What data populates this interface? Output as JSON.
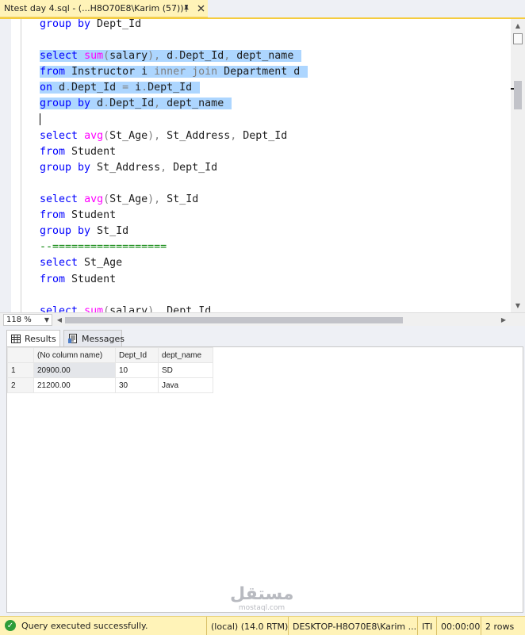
{
  "tab": {
    "title": "Ntest day 4.sql - (...H8O70E8\\Karim (57))",
    "pin_icon": "pin-icon",
    "close_icon": "close-icon"
  },
  "editor": {
    "lines": [
      {
        "parts": [
          {
            "t": "group by",
            "c": "kw"
          },
          {
            "t": " Dept_Id",
            "c": ""
          }
        ]
      },
      {
        "parts": []
      },
      {
        "sel": true,
        "parts": [
          {
            "t": "select",
            "c": "kw"
          },
          {
            "t": " ",
            "c": ""
          },
          {
            "t": "sum",
            "c": "fn"
          },
          {
            "t": "(",
            "c": "gray"
          },
          {
            "t": "salary",
            "c": ""
          },
          {
            "t": "),",
            "c": "gray"
          },
          {
            "t": " d",
            "c": ""
          },
          {
            "t": ".",
            "c": "gray"
          },
          {
            "t": "Dept_Id",
            "c": ""
          },
          {
            "t": ",",
            "c": "gray"
          },
          {
            "t": " dept_name ",
            "c": ""
          }
        ]
      },
      {
        "sel": true,
        "parts": [
          {
            "t": "from",
            "c": "kw"
          },
          {
            "t": " Instructor i ",
            "c": ""
          },
          {
            "t": "inner join",
            "c": "gray"
          },
          {
            "t": " Department d ",
            "c": ""
          }
        ]
      },
      {
        "sel": true,
        "parts": [
          {
            "t": "on",
            "c": "kw"
          },
          {
            "t": " d",
            "c": ""
          },
          {
            "t": ".",
            "c": "gray"
          },
          {
            "t": "Dept_Id ",
            "c": ""
          },
          {
            "t": "=",
            "c": "gray"
          },
          {
            "t": " i",
            "c": ""
          },
          {
            "t": ".",
            "c": "gray"
          },
          {
            "t": "Dept_Id ",
            "c": ""
          }
        ]
      },
      {
        "sel": true,
        "parts": [
          {
            "t": "group by",
            "c": "kw"
          },
          {
            "t": " d",
            "c": ""
          },
          {
            "t": ".",
            "c": "gray"
          },
          {
            "t": "Dept_Id",
            "c": ""
          },
          {
            "t": ",",
            "c": "gray"
          },
          {
            "t": " dept_name ",
            "c": ""
          }
        ]
      },
      {
        "caret": true,
        "parts": []
      },
      {
        "parts": [
          {
            "t": "select",
            "c": "kw"
          },
          {
            "t": " ",
            "c": ""
          },
          {
            "t": "avg",
            "c": "fn"
          },
          {
            "t": "(",
            "c": "gray"
          },
          {
            "t": "St_Age",
            "c": ""
          },
          {
            "t": "),",
            "c": "gray"
          },
          {
            "t": " St_Address",
            "c": ""
          },
          {
            "t": ",",
            "c": "gray"
          },
          {
            "t": " Dept_Id",
            "c": ""
          }
        ]
      },
      {
        "parts": [
          {
            "t": "from",
            "c": "kw"
          },
          {
            "t": " Student",
            "c": ""
          }
        ]
      },
      {
        "parts": [
          {
            "t": "group by",
            "c": "kw"
          },
          {
            "t": " St_Address",
            "c": ""
          },
          {
            "t": ",",
            "c": "gray"
          },
          {
            "t": " Dept_Id",
            "c": ""
          }
        ]
      },
      {
        "parts": []
      },
      {
        "parts": [
          {
            "t": "select",
            "c": "kw"
          },
          {
            "t": " ",
            "c": ""
          },
          {
            "t": "avg",
            "c": "fn"
          },
          {
            "t": "(",
            "c": "gray"
          },
          {
            "t": "St_Age",
            "c": ""
          },
          {
            "t": "),",
            "c": "gray"
          },
          {
            "t": " St_Id",
            "c": ""
          }
        ]
      },
      {
        "parts": [
          {
            "t": "from",
            "c": "kw"
          },
          {
            "t": " Student",
            "c": ""
          }
        ]
      },
      {
        "parts": [
          {
            "t": "group by",
            "c": "kw"
          },
          {
            "t": " St_Id",
            "c": ""
          }
        ]
      },
      {
        "parts": [
          {
            "t": "--==================",
            "c": "cmt"
          }
        ]
      },
      {
        "parts": [
          {
            "t": "select",
            "c": "kw"
          },
          {
            "t": " St_Age",
            "c": ""
          }
        ]
      },
      {
        "parts": [
          {
            "t": "from",
            "c": "kw"
          },
          {
            "t": " Student",
            "c": ""
          }
        ]
      },
      {
        "parts": []
      },
      {
        "parts": [
          {
            "t": "select",
            "c": "kw"
          },
          {
            "t": " ",
            "c": ""
          },
          {
            "t": "sum",
            "c": "fn"
          },
          {
            "t": "(",
            "c": "gray"
          },
          {
            "t": "salary",
            "c": ""
          },
          {
            "t": "),",
            "c": "gray"
          },
          {
            "t": " Dept_Id",
            "c": ""
          }
        ]
      }
    ]
  },
  "zoom": {
    "value": "118 %"
  },
  "results_tabs": {
    "results": "Results",
    "messages": "Messages"
  },
  "grid": {
    "headers": [
      "(No column name)",
      "Dept_Id",
      "dept_name"
    ],
    "rows": [
      {
        "num": "1",
        "cells": [
          "20900.00",
          "10",
          "SD"
        ]
      },
      {
        "num": "2",
        "cells": [
          "21200.00",
          "30",
          "Java"
        ]
      }
    ]
  },
  "watermark": {
    "big": "مستقل",
    "small": "mostaql.com"
  },
  "status": {
    "message": "Query executed successfully.",
    "server": "(local) (14.0 RTM)",
    "login": "DESKTOP-H8O70E8\\Karim ...",
    "database": "ITI",
    "elapsed": "00:00:00",
    "rows": "2 rows"
  },
  "colors": {
    "selection": "#add6ff",
    "keyword": "#0000ff",
    "function": "#ff00ff",
    "comment": "#008000",
    "tab_active": "#fff3b8"
  }
}
